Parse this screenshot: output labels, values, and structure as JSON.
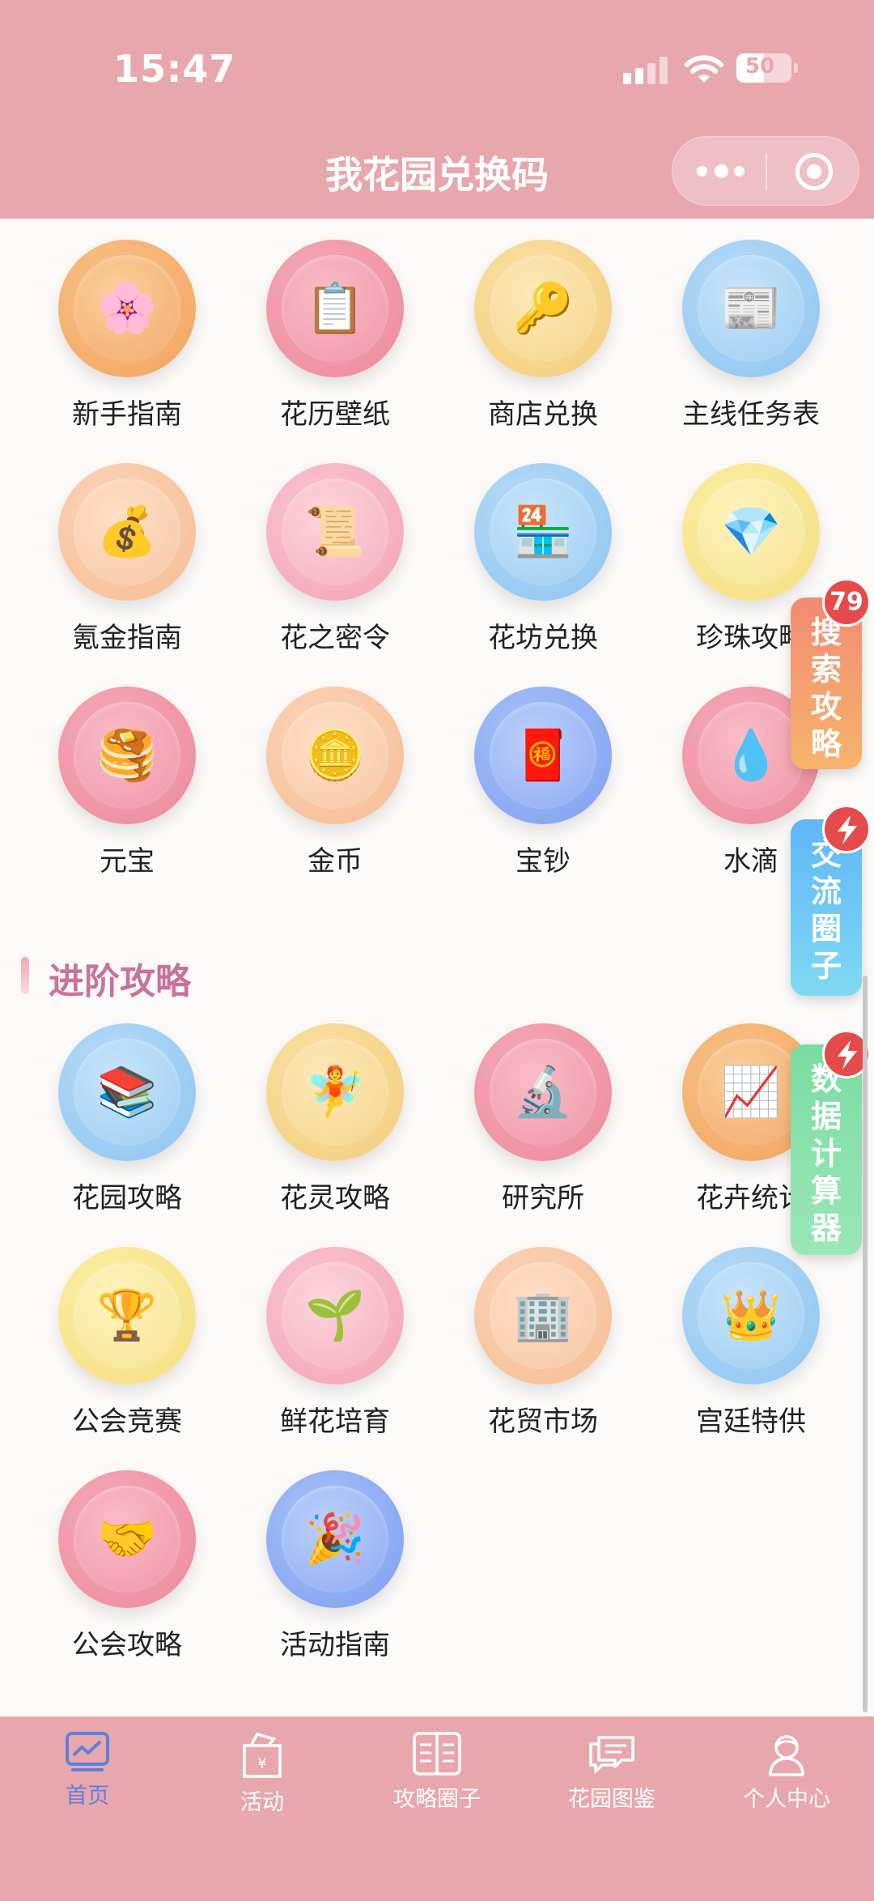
{
  "status_bar": {
    "time": "15:47",
    "battery": "50"
  },
  "header": {
    "title": "我花园兑换码"
  },
  "grid1": [
    {
      "label": "新手指南",
      "icon": "cherry-blossom-icon",
      "glyph": "🌸",
      "color": "c-orange"
    },
    {
      "label": "花历壁纸",
      "icon": "clipboard-icon",
      "glyph": "📋",
      "color": "c-pink"
    },
    {
      "label": "商店兑换",
      "icon": "key-icon",
      "glyph": "🔑",
      "color": "c-yellow"
    },
    {
      "label": "主线任务表",
      "icon": "newspaper-icon",
      "glyph": "📰",
      "color": "c-blue"
    },
    {
      "label": "氪金指南",
      "icon": "money-bag-icon",
      "glyph": "💰",
      "color": "c-peach"
    },
    {
      "label": "花之密令",
      "icon": "scroll-icon",
      "glyph": "📜",
      "color": "c-lpink"
    },
    {
      "label": "花坊兑换",
      "icon": "convenience-store-icon",
      "glyph": "🏪",
      "color": "c-blue"
    },
    {
      "label": "珍珠攻略",
      "icon": "gem-icon",
      "glyph": "💎",
      "color": "c-lyellow"
    },
    {
      "label": "元宝",
      "icon": "pancakes-icon",
      "glyph": "🥞",
      "color": "c-pink"
    },
    {
      "label": "金币",
      "icon": "coin-icon",
      "glyph": "🪙",
      "color": "c-peach"
    },
    {
      "label": "宝钞",
      "icon": "red-envelope-icon",
      "glyph": "🧧",
      "color": "c-royal"
    },
    {
      "label": "水滴",
      "icon": "droplet-icon",
      "glyph": "💧",
      "color": "c-pink"
    }
  ],
  "advanced": {
    "title": "进阶攻略",
    "items": [
      {
        "label": "花园攻略",
        "icon": "books-icon",
        "glyph": "📚",
        "color": "c-blue"
      },
      {
        "label": "花灵攻略",
        "icon": "fairy-icon",
        "glyph": "🧚",
        "color": "c-yellow"
      },
      {
        "label": "研究所",
        "icon": "microscope-icon",
        "glyph": "🔬",
        "color": "c-pink"
      },
      {
        "label": "花卉统计",
        "icon": "chart-increasing-icon",
        "glyph": "📈",
        "color": "c-orange"
      },
      {
        "label": "公会竞赛",
        "icon": "trophy-icon",
        "glyph": "🏆",
        "color": "c-lyellow"
      },
      {
        "label": "鲜花培育",
        "icon": "seedling-icon",
        "glyph": "🌱",
        "color": "c-lpink"
      },
      {
        "label": "花贸市场",
        "icon": "office-building-icon",
        "glyph": "🏢",
        "color": "c-peach"
      },
      {
        "label": "宫廷特供",
        "icon": "crown-icon",
        "glyph": "👑",
        "color": "c-blue"
      },
      {
        "label": "公会攻略",
        "icon": "handshake-icon",
        "glyph": "🤝",
        "color": "c-pink"
      },
      {
        "label": "活动指南",
        "icon": "party-popper-icon",
        "glyph": "🎉",
        "color": "c-royal"
      }
    ]
  },
  "floating": {
    "search": {
      "label": "搜索攻略",
      "badge": "79"
    },
    "community": {
      "label": "交流圈子"
    },
    "calculator": {
      "label": "数据计算器"
    }
  },
  "tabbar": [
    {
      "label": "首页",
      "icon": "chart-icon",
      "active": true
    },
    {
      "label": "活动",
      "icon": "shopping-bag-icon",
      "active": false
    },
    {
      "label": "攻略圈子",
      "icon": "book-open-icon",
      "active": false
    },
    {
      "label": "花园图鉴",
      "icon": "chat-bubbles-icon",
      "active": false
    },
    {
      "label": "个人中心",
      "icon": "user-icon",
      "active": false
    }
  ]
}
